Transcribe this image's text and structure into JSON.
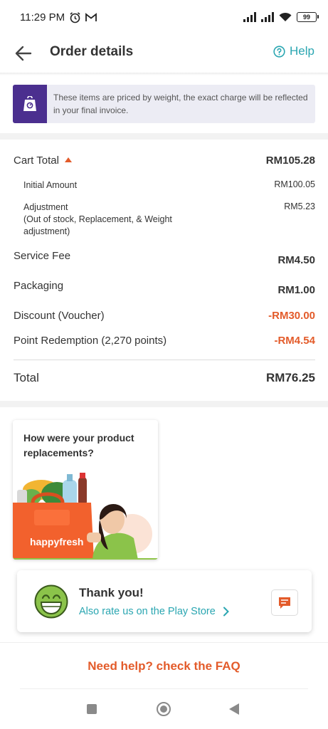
{
  "status_bar": {
    "time": "11:29 PM",
    "battery": "99",
    "icons": [
      "alarm-icon",
      "gmail-icon",
      "signal-icon",
      "signal-icon",
      "wifi-icon",
      "battery-icon"
    ]
  },
  "header": {
    "title": "Order details",
    "help_label": "Help"
  },
  "notice": {
    "text": "These items are priced by weight, the exact charge will be reflected in your final invoice.",
    "icon": "weight-scale-icon"
  },
  "breakdown": {
    "cart_total_label": "Cart Total",
    "cart_total_value": "RM105.28",
    "initial_amount_label": "Initial Amount",
    "initial_amount_value": "RM100.05",
    "adjustment_label": "Adjustment",
    "adjustment_note": "(Out of stock, Replacement, & Weight adjustment)",
    "adjustment_value": "RM5.23",
    "service_fee_label": "Service Fee",
    "service_fee_value": "RM4.50",
    "packaging_label": "Packaging",
    "packaging_value": "RM1.00",
    "discount_label": "Discount (Voucher)",
    "discount_value": "-RM30.00",
    "points_label": "Point Redemption (2,270 points)",
    "points_value": "-RM4.54",
    "total_label": "Total",
    "total_value": "RM76.25"
  },
  "survey_card": {
    "title": "How were your product replacements?",
    "brand": "happyfresh"
  },
  "thanks_card": {
    "title": "Thank you!",
    "link": "Also rate us on the Play Store"
  },
  "faq": {
    "label": "Need help? check the FAQ"
  },
  "colors": {
    "accent_teal": "#2aa6b1",
    "accent_orange": "#e35b2a",
    "notice_purple": "#4b2f8f"
  }
}
